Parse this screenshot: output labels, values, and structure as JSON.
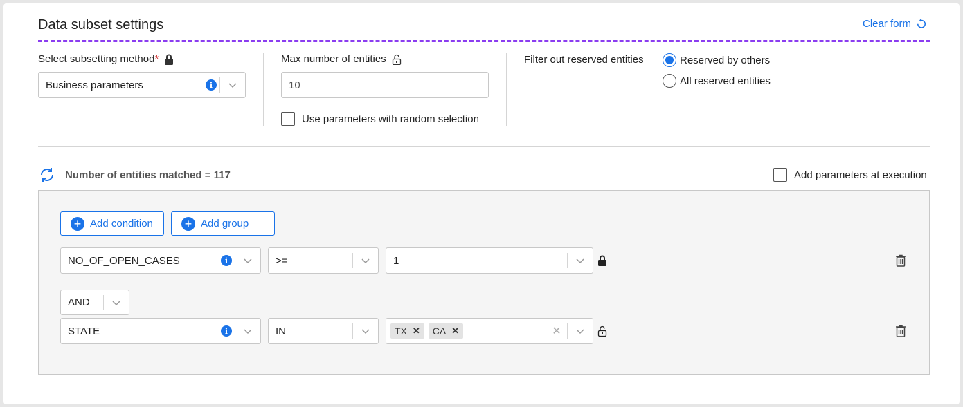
{
  "header": {
    "title": "Data subset settings",
    "clear_label": "Clear form"
  },
  "subset_method": {
    "label": "Select subsetting method",
    "required_mark": "*",
    "value": "Business parameters"
  },
  "max_entities": {
    "label": "Max number of entities",
    "value": "10",
    "random_label": "Use parameters with random selection"
  },
  "reserved": {
    "label": "Filter out reserved entities",
    "options": [
      "Reserved by others",
      "All reserved entities"
    ],
    "selected": "Reserved by others"
  },
  "matched": {
    "label": "Number of entities matched = 117",
    "add_params_label": "Add parameters at execution"
  },
  "actions": {
    "add_condition": "Add condition",
    "add_group": "Add group"
  },
  "conditions": [
    {
      "field": "NO_OF_OPEN_CASES",
      "operator": ">=",
      "value": "1",
      "lock": "locked"
    },
    {
      "field": "STATE",
      "operator": "IN",
      "tags": [
        "TX",
        "CA"
      ],
      "lock": "unlocked"
    }
  ],
  "logic": {
    "operator": "AND"
  },
  "colors": {
    "accent": "#1a73e8",
    "dashed": "#8b3df0",
    "required": "#d32f2f"
  },
  "icons": [
    "refresh-icon",
    "lock-icon",
    "unlock-icon",
    "info-icon",
    "chevron-down-icon",
    "trash-icon",
    "plus-icon",
    "sync-icon",
    "clear-icon"
  ]
}
